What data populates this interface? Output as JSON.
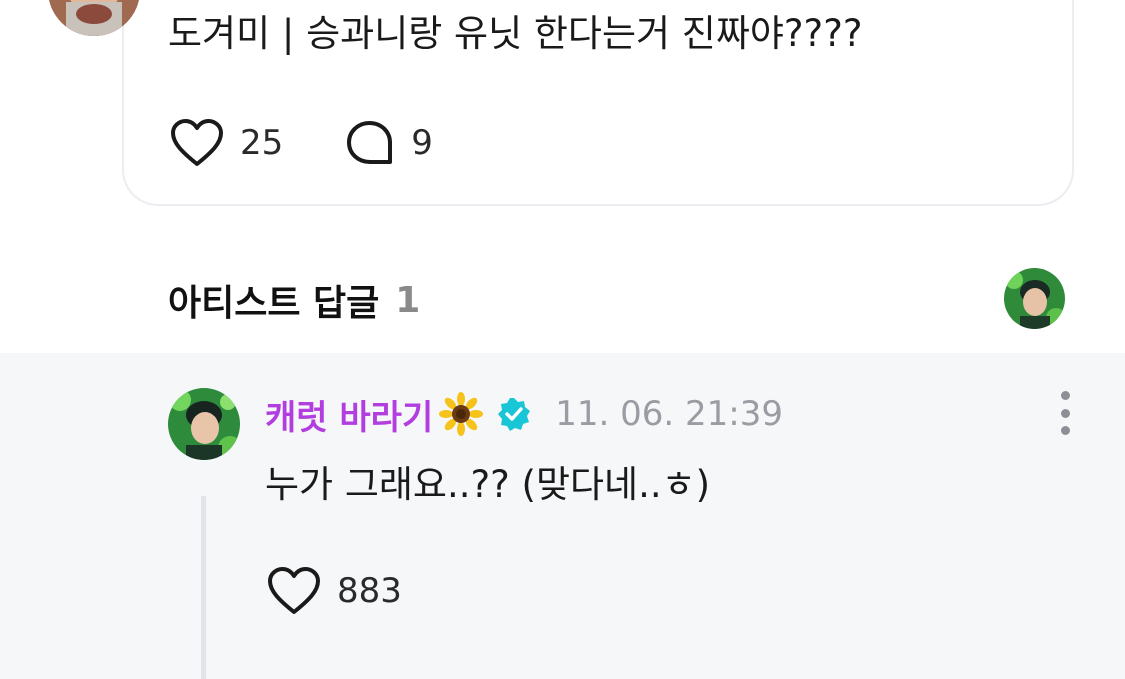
{
  "post": {
    "text": "도겨미 |  승과니랑 유닛 한다는거 진짜야????",
    "like_count": "25",
    "comment_count": "9"
  },
  "section": {
    "title": "아티스트 답글",
    "count": "1"
  },
  "reply": {
    "author": "캐럿 바라기",
    "author_color": "#b23ee0",
    "badge_emoji": "sunflower",
    "verified": true,
    "verified_color": "#19c6d6",
    "timestamp": "11. 06. 21:39",
    "text": "누가 그래요..?? (맞다네..ㅎ)",
    "like_count": "883"
  },
  "icons": {
    "like": "heart-outline-icon",
    "comment": "speech-bubble-icon",
    "more": "vertical-ellipsis-icon"
  }
}
